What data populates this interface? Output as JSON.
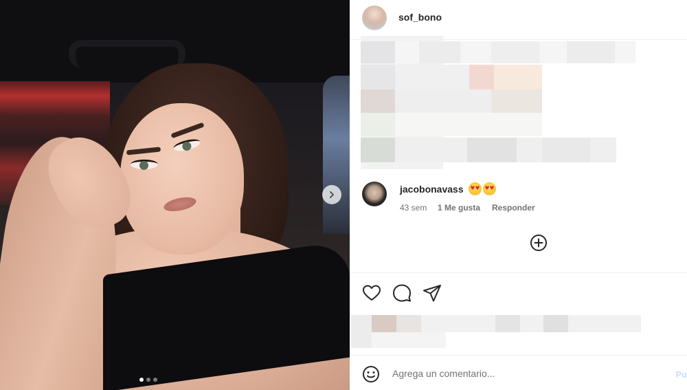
{
  "post": {
    "owner": {
      "username": "sof_bono",
      "avatar_icon": "profile-avatar"
    },
    "media": {
      "carousel_total": 3,
      "carousel_current": 1,
      "next_icon": "chevron-right-icon"
    },
    "caption_blurred": true,
    "comments": [
      {
        "username": "jacobonavass",
        "emoji": [
          "heart-eyes-emoji",
          "heart-eyes-emoji"
        ],
        "time": "43 sem",
        "likes": "1 Me gusta",
        "reply_label": "Responder"
      }
    ],
    "load_more_icon": "plus-circle-icon",
    "actions": {
      "like_icon": "heart-icon",
      "comment_icon": "comment-icon",
      "share_icon": "send-icon"
    },
    "likes_blurred": true,
    "add_comment": {
      "emoji_icon": "smiley-icon",
      "placeholder": "Agrega un comentario...",
      "post_label": "Pu"
    }
  }
}
